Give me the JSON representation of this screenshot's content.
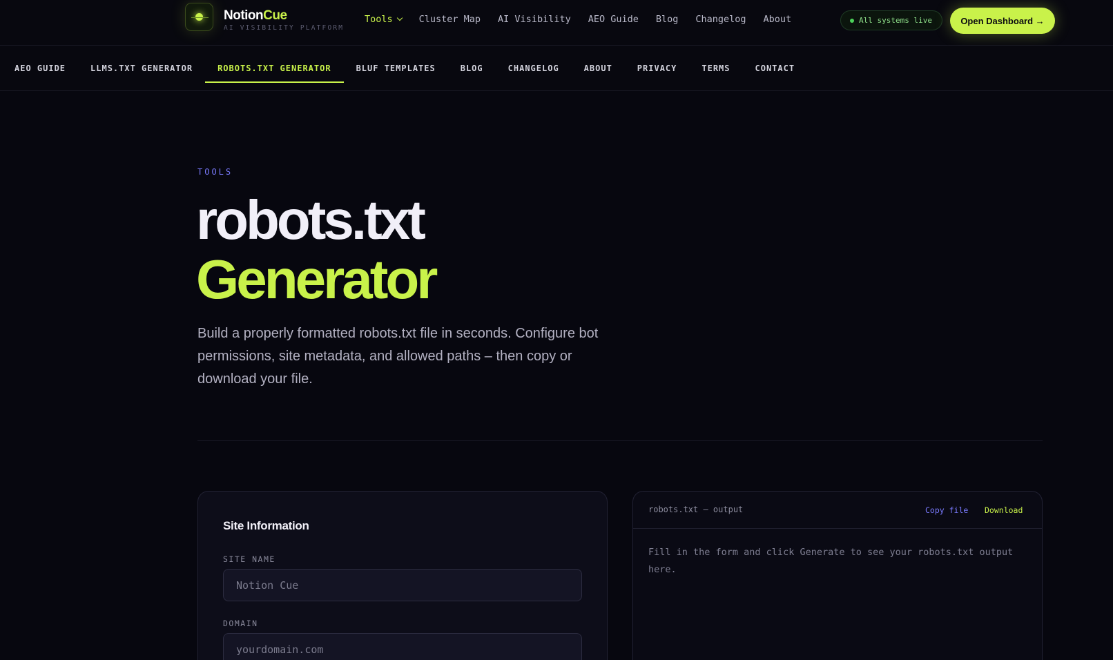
{
  "header": {
    "brand_main": "Notion",
    "brand_accent": "Cue",
    "brand_tagline": "AI VISIBILITY PLATFORM",
    "nav": [
      {
        "label": "Tools"
      },
      {
        "label": "Cluster Map"
      },
      {
        "label": "AI Visibility"
      },
      {
        "label": "AEO Guide"
      },
      {
        "label": "Blog"
      },
      {
        "label": "Changelog"
      },
      {
        "label": "About"
      }
    ],
    "status": "All systems live",
    "cta": "Open Dashboard →"
  },
  "subnav": {
    "items": [
      {
        "label": "AEO GUIDE"
      },
      {
        "label": "LLMS.TXT GENERATOR"
      },
      {
        "label": "ROBOTS.TXT GENERATOR"
      },
      {
        "label": "BLUF TEMPLATES"
      },
      {
        "label": "BLOG"
      },
      {
        "label": "CHANGELOG"
      },
      {
        "label": "ABOUT"
      },
      {
        "label": "PRIVACY"
      },
      {
        "label": "TERMS"
      },
      {
        "label": "CONTACT"
      }
    ],
    "active_index": 2
  },
  "hero": {
    "eyebrow": "TOOLS",
    "title_line1": "robots.txt",
    "title_line2": "Generator",
    "lead": "Build a properly formatted robots.txt file in seconds. Configure bot permissions, site metadata, and allowed paths – then copy or download your file."
  },
  "form": {
    "title": "Site Information",
    "site_name_label": "SITE NAME",
    "site_name_placeholder": "Notion Cue",
    "domain_label": "DOMAIN",
    "domain_placeholder": "yourdomain.com"
  },
  "output": {
    "title": "robots.txt — output",
    "copy_label": "Copy file",
    "download_label": "Download",
    "placeholder": "Fill in the form and click Generate to see your robots.txt output here."
  },
  "colors": {
    "accent": "#c9f24a",
    "secondary": "#7a7bff",
    "background": "#07070f",
    "status": "#4cd35a"
  }
}
